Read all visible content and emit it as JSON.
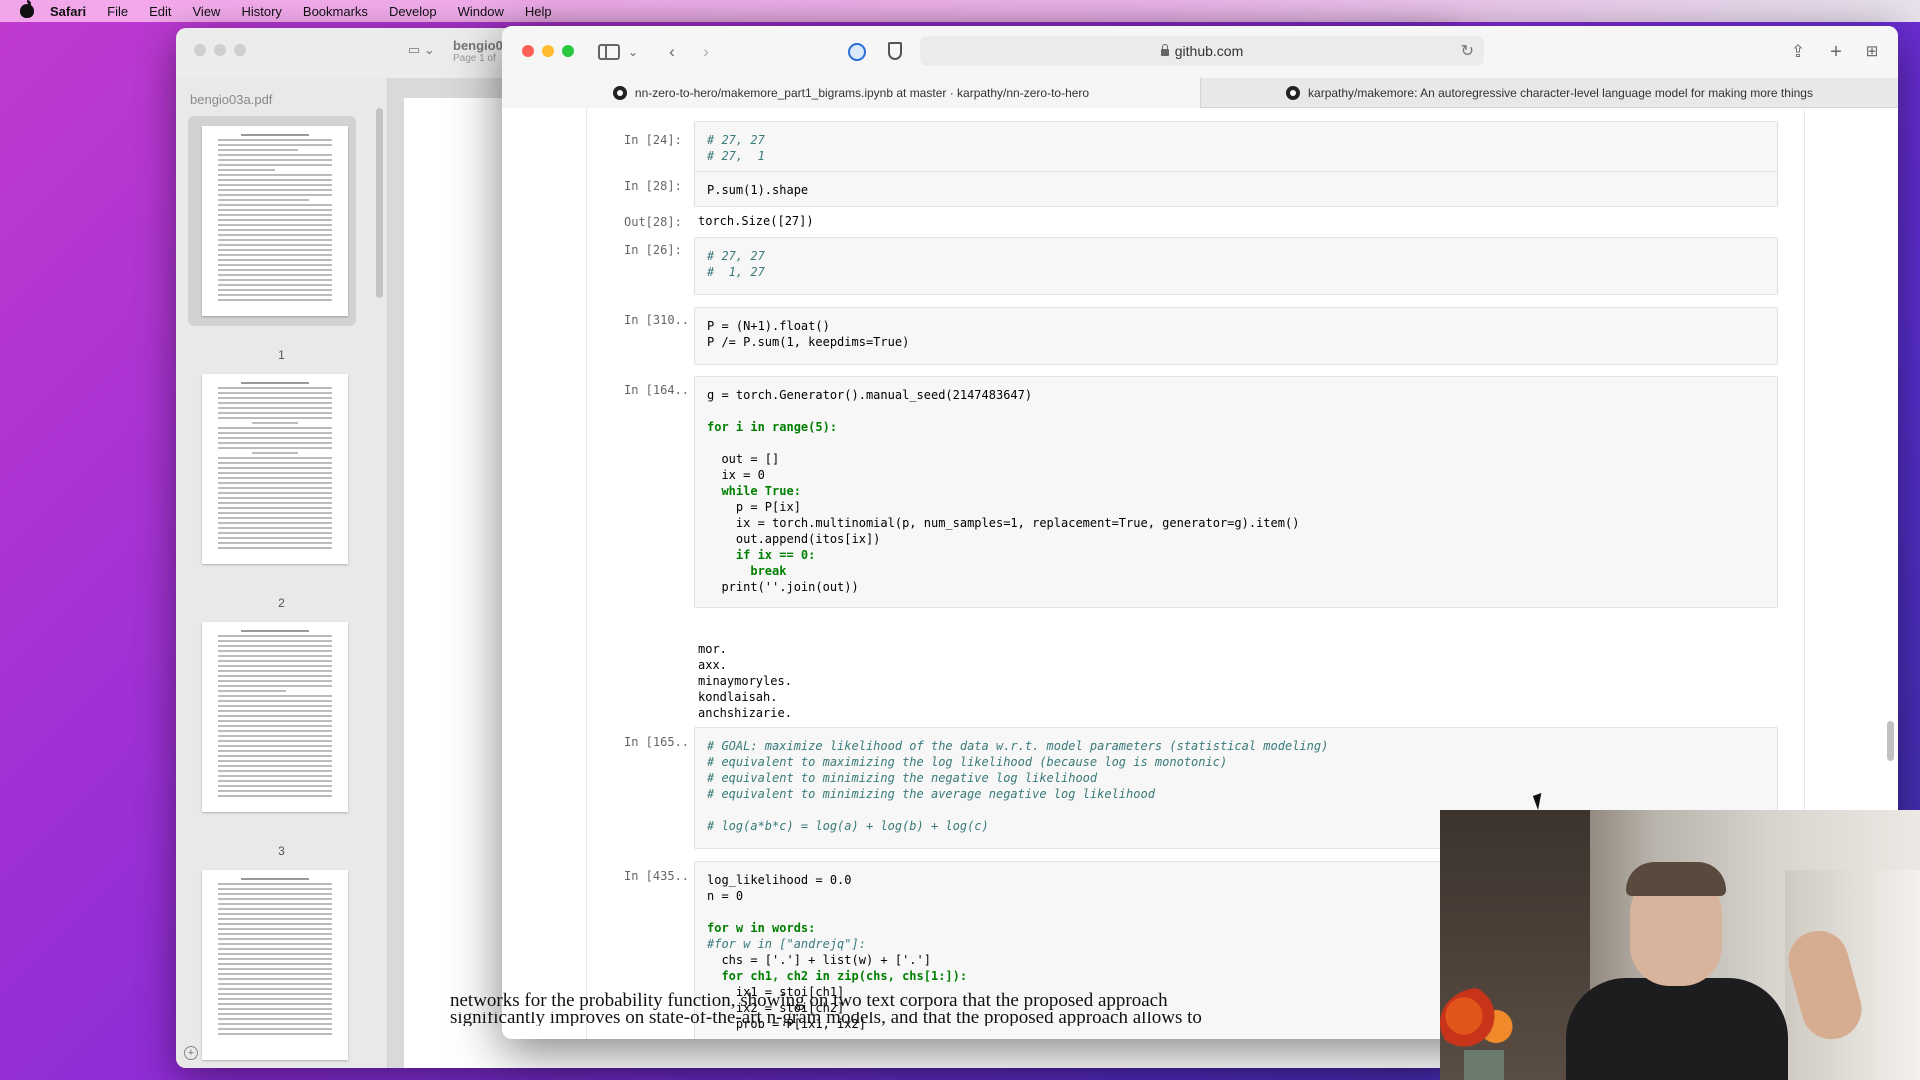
{
  "menubar": {
    "app": "Safari",
    "items": [
      "File",
      "Edit",
      "View",
      "History",
      "Bookmarks",
      "Develop",
      "Window",
      "Help"
    ]
  },
  "preview": {
    "title": "bengio03a.pdf",
    "page_info": "Page 1 of",
    "filename": "bengio03a.pdf",
    "pages": [
      "1",
      "2",
      "3"
    ],
    "visible_text": "networks for the probability function, showing on two text corpora that the proposed approach",
    "visible_text_2": "significantly improves on state-of-the-art n-gram models, and that the proposed approach allows to"
  },
  "safari": {
    "address": "github.com",
    "tabs": [
      "nn-zero-to-hero/makemore_part1_bigrams.ipynb at master · karpathy/nn-zero-to-hero",
      "karpathy/makemore: An autoregressive character-level language model for making more things"
    ]
  },
  "notebook": {
    "cells": [
      {
        "prompt": "In [24]:",
        "lines": [
          "# 27, 27",
          "# 27,  1"
        ]
      },
      {
        "prompt": "In [28]:",
        "lines": [
          "P.sum(1).shape"
        ],
        "out_prompt": "Out[28]:",
        "output": "torch.Size([27])"
      },
      {
        "prompt": "In [26]:",
        "lines": [
          "# 27, 27",
          "#  1, 27"
        ]
      },
      {
        "prompt": "In [310...",
        "lines": [
          "P = (N+1).float()",
          "P /= P.sum(1, keepdims=True)"
        ]
      },
      {
        "prompt": "In [164...",
        "lines": [
          "g = torch.Generator().manual_seed(2147483647)",
          "",
          "for i in range(5):",
          "",
          "  out = []",
          "  ix = 0",
          "  while True:",
          "    p = P[ix]",
          "    ix = torch.multinomial(p, num_samples=1, replacement=True, generator=g).item()",
          "    out.append(itos[ix])",
          "    if ix == 0:",
          "      break",
          "  print(''.join(out))"
        ],
        "output": "mor.\naxx.\nminaymoryles.\nkondlaisah.\nanchshizarie."
      },
      {
        "prompt": "In [165...",
        "lines": [
          "# GOAL: maximize likelihood of the data w.r.t. model parameters (statistical modeling)",
          "# equivalent to maximizing the log likelihood (because log is monotonic)",
          "# equivalent to minimizing the negative log likelihood",
          "# equivalent to minimizing the average negative log likelihood",
          "",
          "# log(a*b*c) = log(a) + log(b) + log(c)"
        ]
      },
      {
        "prompt": "In [435...",
        "lines": [
          "log_likelihood = 0.0",
          "n = 0",
          "",
          "for w in words:",
          "#for w in [\"andrejq\"]:",
          "  chs = ['.'] + list(w) + ['.']",
          "  for ch1, ch2 in zip(chs, chs[1:]):",
          "    ix1 = stoi[ch1]",
          "    ix2 = stoi[ch2]",
          "    prob = P[ix1, ix2]"
        ]
      }
    ]
  },
  "colors": {
    "comment": "#3a7a7a",
    "keyword": "#008000",
    "number": "#008000"
  },
  "icons": [
    "apple-icon",
    "sidebar-icon",
    "back-icon",
    "forward-icon",
    "password-icon",
    "shield-icon",
    "lock-icon",
    "reload-icon",
    "share-icon",
    "new-tab-icon",
    "tab-overview-icon",
    "github-icon",
    "cursor-icon"
  ]
}
